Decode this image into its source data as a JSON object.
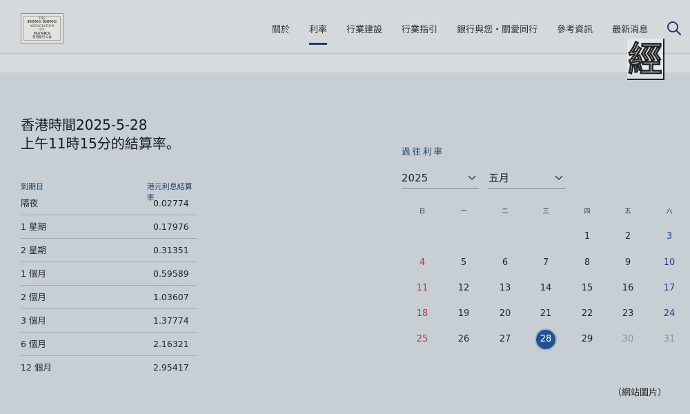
{
  "header": {
    "logo": [
      "THE",
      "HONG KONG",
      "ASSOCIATION",
      "OF",
      "BANKS",
      "香港銀行公會"
    ],
    "nav": [
      "關於",
      "利率",
      "行業建設",
      "行業指引",
      "銀行與您・關愛同行",
      "參考資訊",
      "最新消息"
    ],
    "active_nav": "利率"
  },
  "watermark": "經",
  "heading": {
    "line1": "香港時間2025-5-28",
    "line2": "上午11時15分的結算率。"
  },
  "rates": {
    "col1": "到期日",
    "col2": "港元利息結算率",
    "rows": [
      {
        "tenor": "隔夜",
        "rate": "0.02774"
      },
      {
        "tenor": "1 星期",
        "rate": "0.17976"
      },
      {
        "tenor": "2 星期",
        "rate": "0.31351"
      },
      {
        "tenor": "1 個月",
        "rate": "0.59589"
      },
      {
        "tenor": "2 個月",
        "rate": "1.03607"
      },
      {
        "tenor": "3 個月",
        "rate": "1.37774"
      },
      {
        "tenor": "6 個月",
        "rate": "2.16321"
      },
      {
        "tenor": "12 個月",
        "rate": "2.95417"
      }
    ]
  },
  "calendar": {
    "title": "過往利率",
    "year": "2025",
    "month": "五月",
    "weekdays": [
      "日",
      "一",
      "二",
      "三",
      "四",
      "五",
      "六"
    ],
    "weeks": [
      [
        "",
        "",
        "",
        "",
        "1",
        "2",
        "3"
      ],
      [
        "4",
        "5",
        "6",
        "7",
        "8",
        "9",
        "10"
      ],
      [
        "11",
        "12",
        "13",
        "14",
        "15",
        "16",
        "17"
      ],
      [
        "18",
        "19",
        "20",
        "21",
        "22",
        "23",
        "24"
      ],
      [
        "25",
        "26",
        "27",
        "28",
        "29",
        "30",
        "31"
      ]
    ],
    "selected": "28",
    "muted_days": [
      "30",
      "31"
    ]
  },
  "caption": "（網站圖片）",
  "colors": {
    "accent": "#1f3f6e",
    "sunday": "#c03535",
    "saturday": "#1f3f8e",
    "selected": "#22528f"
  }
}
